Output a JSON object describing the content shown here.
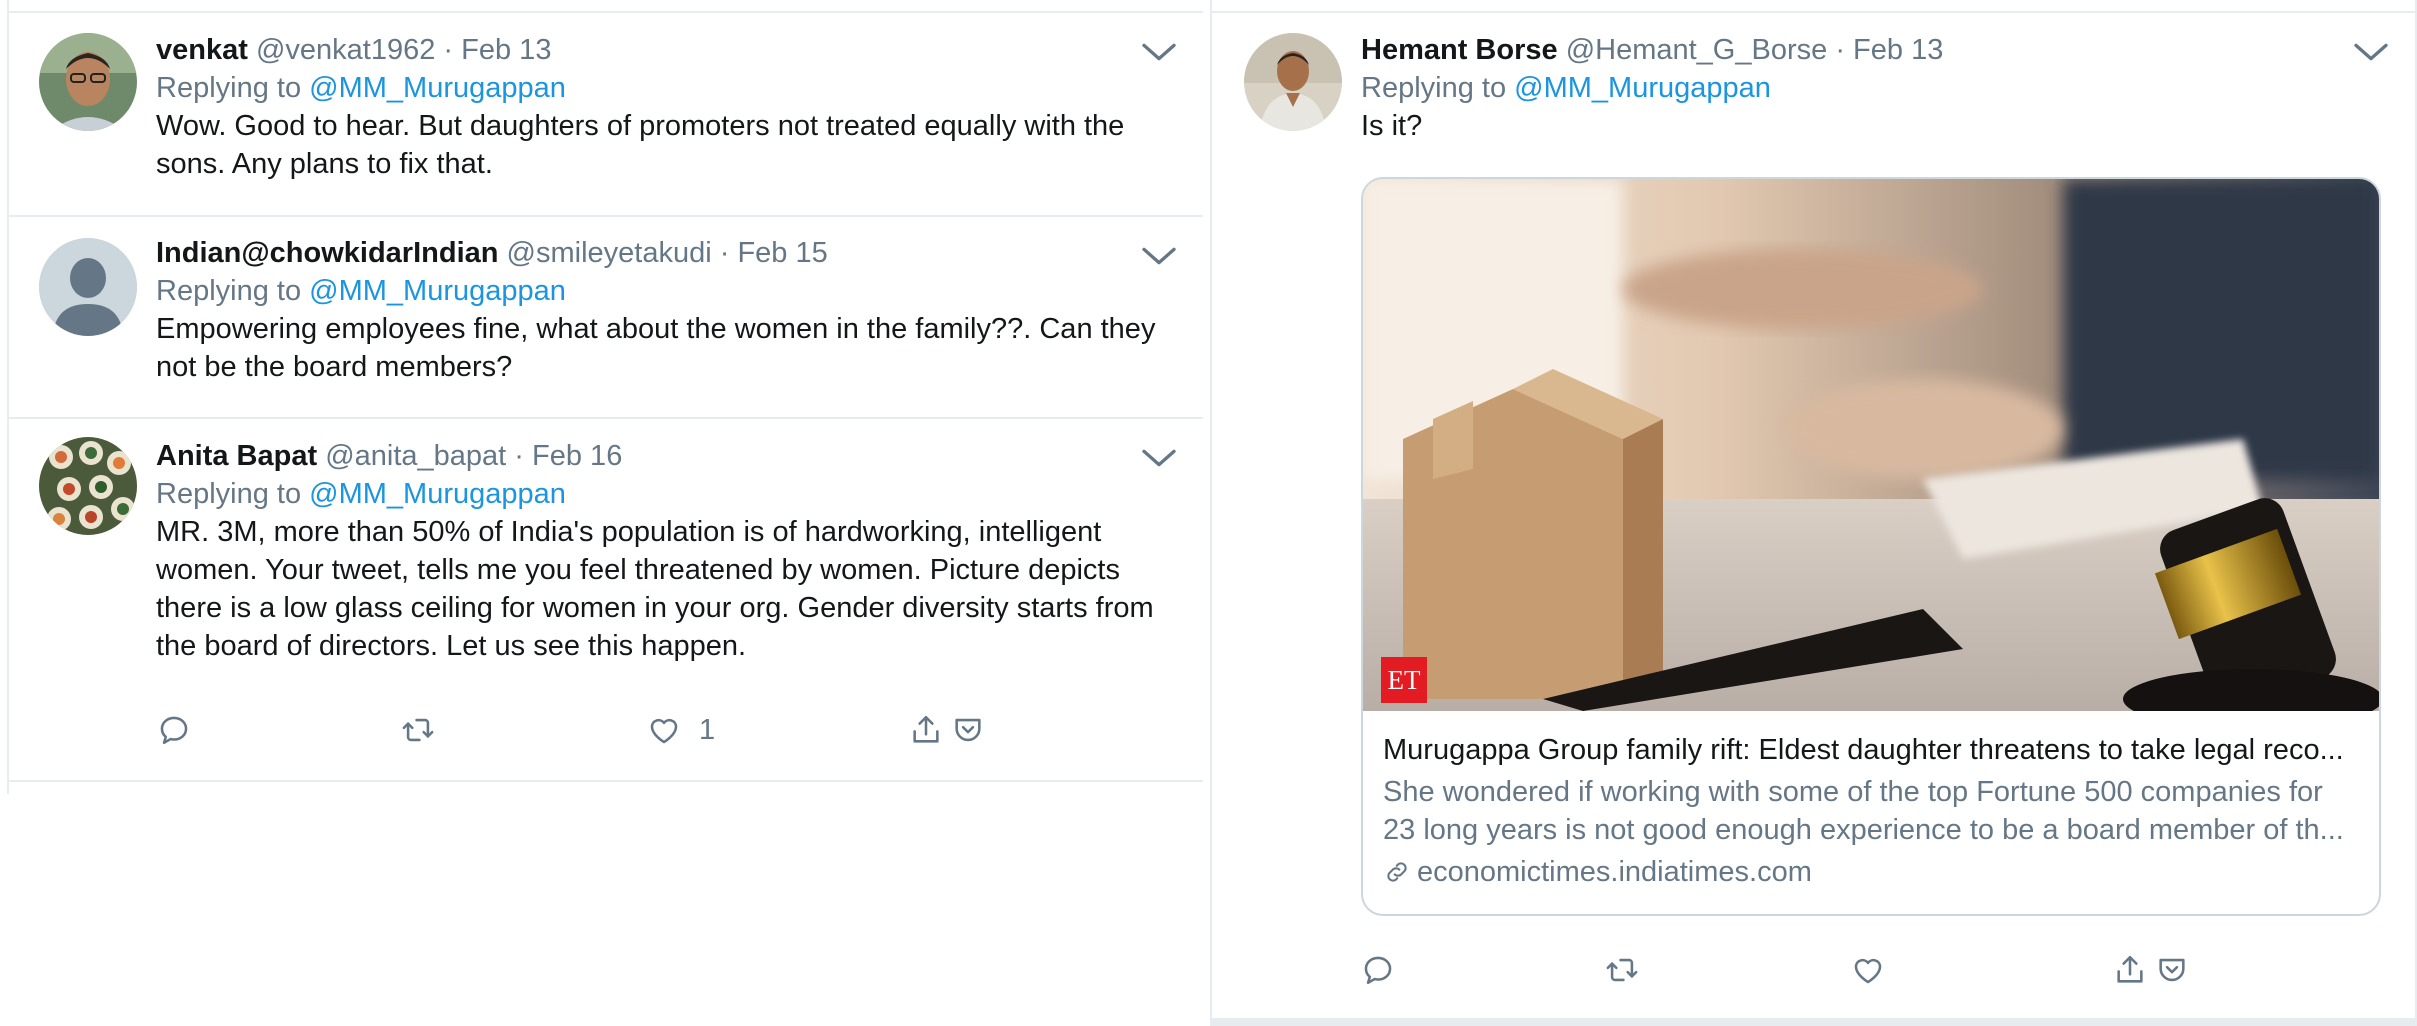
{
  "left_column": {
    "tweets": [
      {
        "name": "venkat",
        "handle": "@venkat1962",
        "separator": "·",
        "date": "Feb 13",
        "replying_prefix": "Replying to",
        "replying_mention": "@MM_Murugappan",
        "text_lines": [
          "Wow. Good to hear. But daughters of promoters not treated equally with the",
          "sons. Any plans to fix that."
        ]
      },
      {
        "name": "Indian@chowkidarIndian",
        "handle": "@smileyetakudi",
        "separator": "·",
        "date": "Feb 15",
        "replying_prefix": "Replying to",
        "replying_mention": "@MM_Murugappan",
        "text_lines": [
          "Empowering employees fine, what about the women in the family??. Can they",
          "not be the board members?"
        ]
      },
      {
        "name": "Anita Bapat",
        "handle": "@anita_bapat",
        "separator": "·",
        "date": "Feb 16",
        "replying_prefix": "Replying to",
        "replying_mention": "@MM_Murugappan",
        "text_lines": [
          "MR. 3M, more than 50% of India's population is of hardworking, intelligent",
          "women. Your tweet, tells me you feel threatened by women. Picture depicts",
          "there is a low glass ceiling for women in your org. Gender diversity starts from",
          "the board of directors. Let us see this happen."
        ],
        "like_count": "1"
      }
    ]
  },
  "right_column": {
    "tweet": {
      "name": "Hemant Borse",
      "handle": "@Hemant_G_Borse",
      "separator": "·",
      "date": "Feb 13",
      "replying_prefix": "Replying to",
      "replying_mention": "@MM_Murugappan",
      "text": "Is it?",
      "card": {
        "badge": "ET",
        "title": "Murugappa Group family rift: Eldest daughter threatens to take legal reco...",
        "description_lines": [
          "She wondered if working with some of the top Fortune 500 companies for",
          "23 long years is not good enough experience to be a board member of th..."
        ],
        "domain": "economictimes.indiatimes.com"
      }
    }
  },
  "icons": {
    "reply": "reply-icon",
    "retweet": "retweet-icon",
    "like": "heart-icon",
    "share": "share-icon",
    "pocket": "pocket-icon",
    "more": "chevron-down-icon",
    "link": "link-icon"
  },
  "colors": {
    "link_blue": "#1b95e0",
    "secondary_text": "#657786",
    "primary_text": "#14171a",
    "border": "#e6ecf0",
    "et_red": "#e31b23"
  }
}
